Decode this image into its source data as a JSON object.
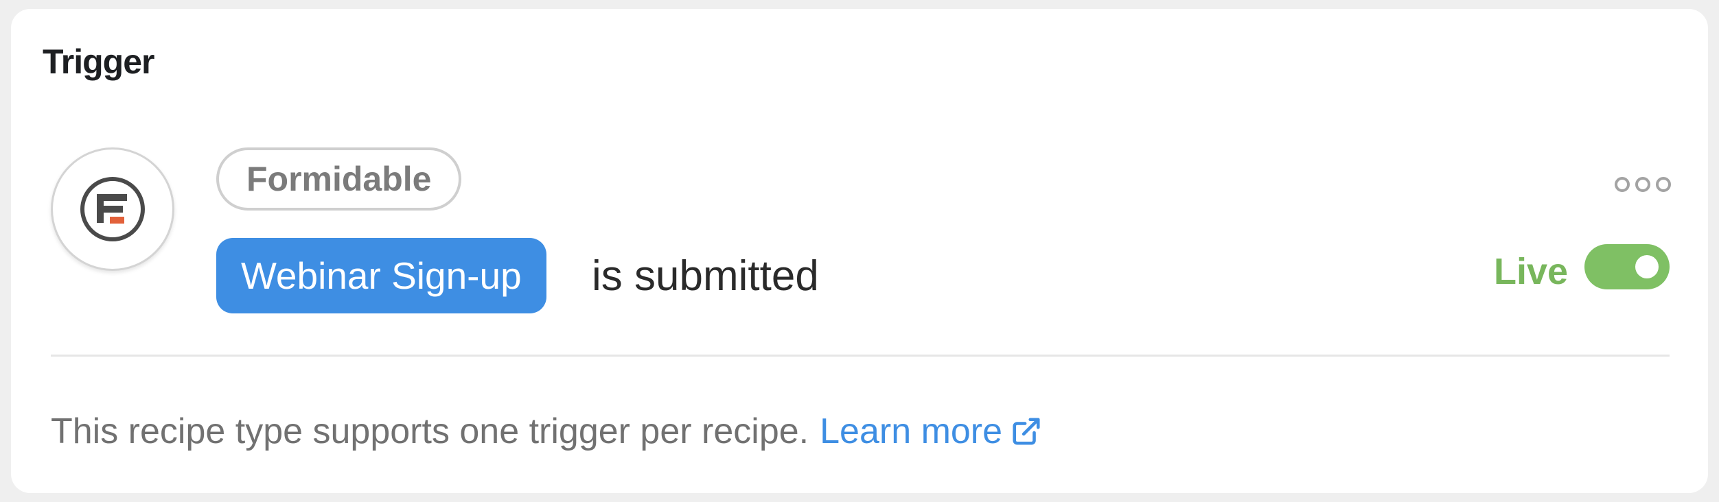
{
  "card": {
    "title": "Trigger"
  },
  "trigger": {
    "integration_name": "Formidable",
    "integration_icon": "formidable-logo-icon",
    "form_token": "Webinar Sign-up",
    "sentence_tail": "is submitted",
    "status_label": "Live",
    "status_on": true
  },
  "footer": {
    "note": "This recipe type supports one trigger per recipe.",
    "link_label": "Learn more",
    "link_icon": "external-link-icon"
  },
  "colors": {
    "accent_blue": "#3e8ee3",
    "live_green": "#78b65c",
    "toggle_green": "#7fc064",
    "formidable_orange": "#e2613a",
    "formidable_dark": "#4a4a4a"
  }
}
